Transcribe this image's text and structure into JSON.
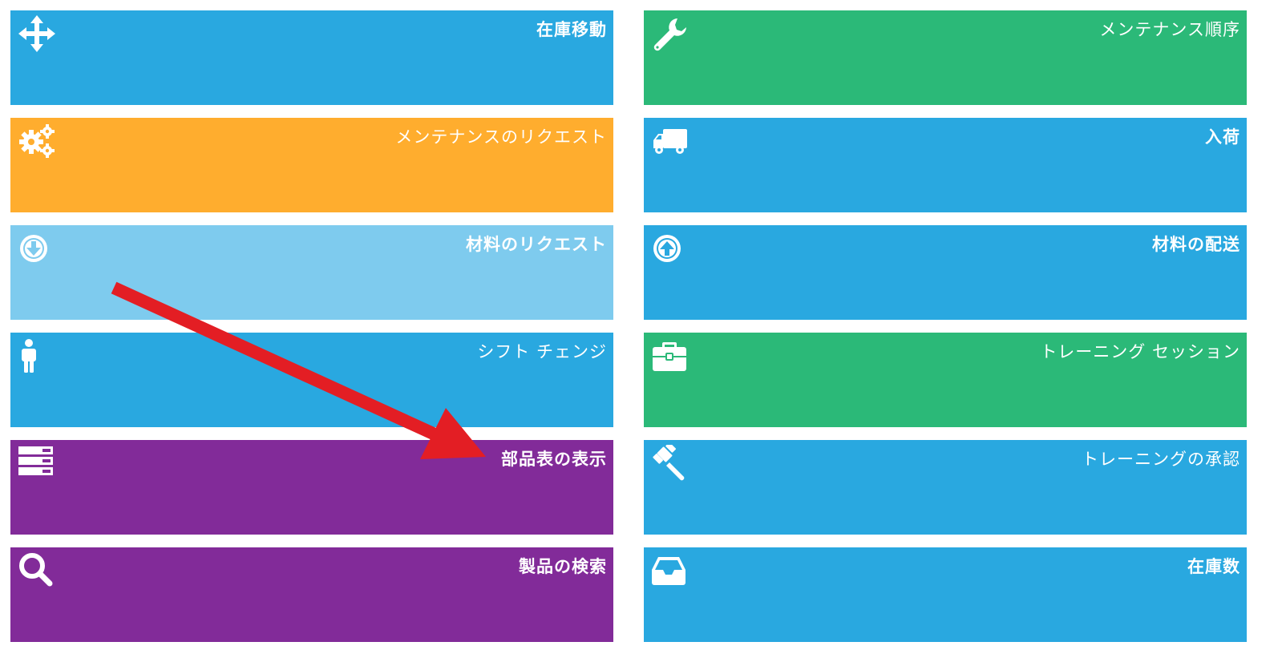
{
  "colors": {
    "blue": "#29a8e0",
    "green": "#2bb978",
    "orange": "#ffad2e",
    "light_blue": "#7ecbee",
    "purple": "#822b99",
    "arrow_red": "#e31e24"
  },
  "tiles": [
    {
      "label": "在庫移動",
      "icon": "move-arrows-icon",
      "color": "#29a8e0"
    },
    {
      "label": "メンテナンス順序",
      "icon": "wrench-icon",
      "color": "#2bb978"
    },
    {
      "label": "メンテナンスのリクエスト",
      "icon": "gears-icon",
      "color": "#ffad2e"
    },
    {
      "label": "入荷",
      "icon": "truck-icon",
      "color": "#29a8e0"
    },
    {
      "label": "材料のリクエスト",
      "icon": "circle-arrow-down-icon",
      "color": "#7ecbee"
    },
    {
      "label": "材料の配送",
      "icon": "circle-arrow-up-icon",
      "color": "#29a8e0"
    },
    {
      "label": "シフト チェンジ",
      "icon": "person-icon",
      "color": "#29a8e0"
    },
    {
      "label": "トレーニング セッション",
      "icon": "briefcase-icon",
      "color": "#2bb978"
    },
    {
      "label": "部品表の表示",
      "icon": "server-stack-icon",
      "color": "#822b99"
    },
    {
      "label": "トレーニングの承認",
      "icon": "gavel-icon",
      "color": "#29a8e0"
    },
    {
      "label": "製品の検索",
      "icon": "search-icon",
      "color": "#822b99"
    },
    {
      "label": "在庫数",
      "icon": "inbox-tray-icon",
      "color": "#29a8e0"
    }
  ],
  "annotation": {
    "arrow": "red-arrow-pointing-to-bom-tile"
  }
}
